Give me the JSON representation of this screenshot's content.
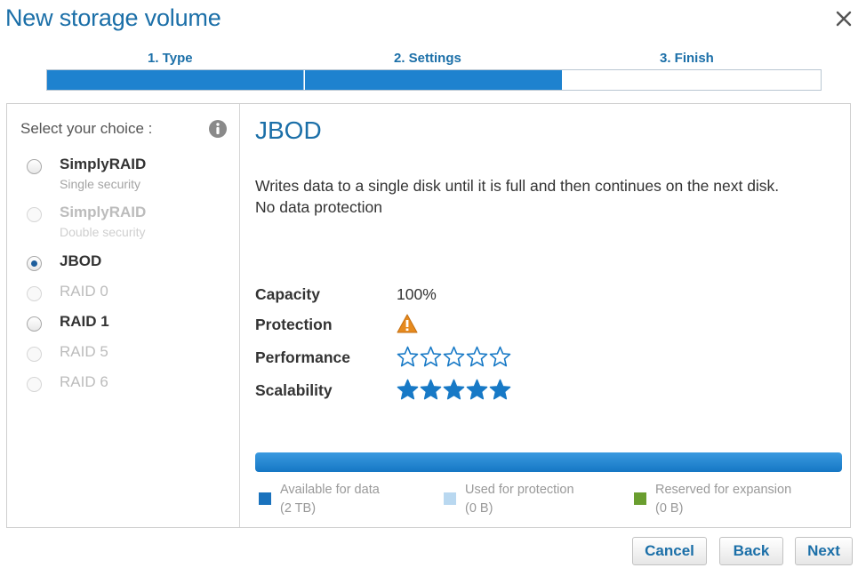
{
  "dialog": {
    "title": "New storage volume",
    "close_icon": "close-icon"
  },
  "steps": [
    {
      "label": "1. Type",
      "state": "done"
    },
    {
      "label": "2. Settings",
      "state": "current"
    },
    {
      "label": "3. Finish",
      "state": "pending"
    }
  ],
  "progress": {
    "completed_fraction": 0.667
  },
  "sidebar": {
    "select_label": "Select your choice :",
    "info_icon": "info-icon",
    "options": [
      {
        "label": "SimplyRAID",
        "sub": "Single security",
        "selected": false,
        "enabled": true
      },
      {
        "label": "SimplyRAID",
        "sub": "Double security",
        "selected": false,
        "enabled": false
      },
      {
        "label": "JBOD",
        "selected": true,
        "enabled": true
      },
      {
        "label": "RAID 0",
        "selected": false,
        "enabled": false
      },
      {
        "label": "RAID 1",
        "selected": false,
        "enabled": true
      },
      {
        "label": "RAID 5",
        "selected": false,
        "enabled": false
      },
      {
        "label": "RAID 6",
        "selected": false,
        "enabled": false
      }
    ]
  },
  "detail": {
    "heading": "JBOD",
    "description_line1": "Writes data to a single disk until it is full and then continues on the next disk.",
    "description_line2": "No data protection",
    "properties": {
      "capacity_label": "Capacity",
      "capacity_value": "100%",
      "protection_label": "Protection",
      "protection_icon": "warning-icon",
      "performance_label": "Performance",
      "performance_stars": 0,
      "scalability_label": "Scalability",
      "scalability_stars": 5,
      "max_stars": 5
    },
    "capacity_bar": {
      "available_fraction": 1.0
    },
    "legend": [
      {
        "label": "Available for data",
        "value": "(2 TB)",
        "color": "#1a72bd"
      },
      {
        "label": "Used for protection",
        "value": "(0 B)",
        "color": "#b9d8f0"
      },
      {
        "label": "Reserved for expansion",
        "value": "(0 B)",
        "color": "#6a9e2f"
      }
    ]
  },
  "buttons": {
    "cancel": "Cancel",
    "back": "Back",
    "next": "Next"
  },
  "colors": {
    "accent": "#1b6fa8",
    "progress": "#1e82cf",
    "warning": "#e68a1e",
    "star": "#1779c6"
  }
}
